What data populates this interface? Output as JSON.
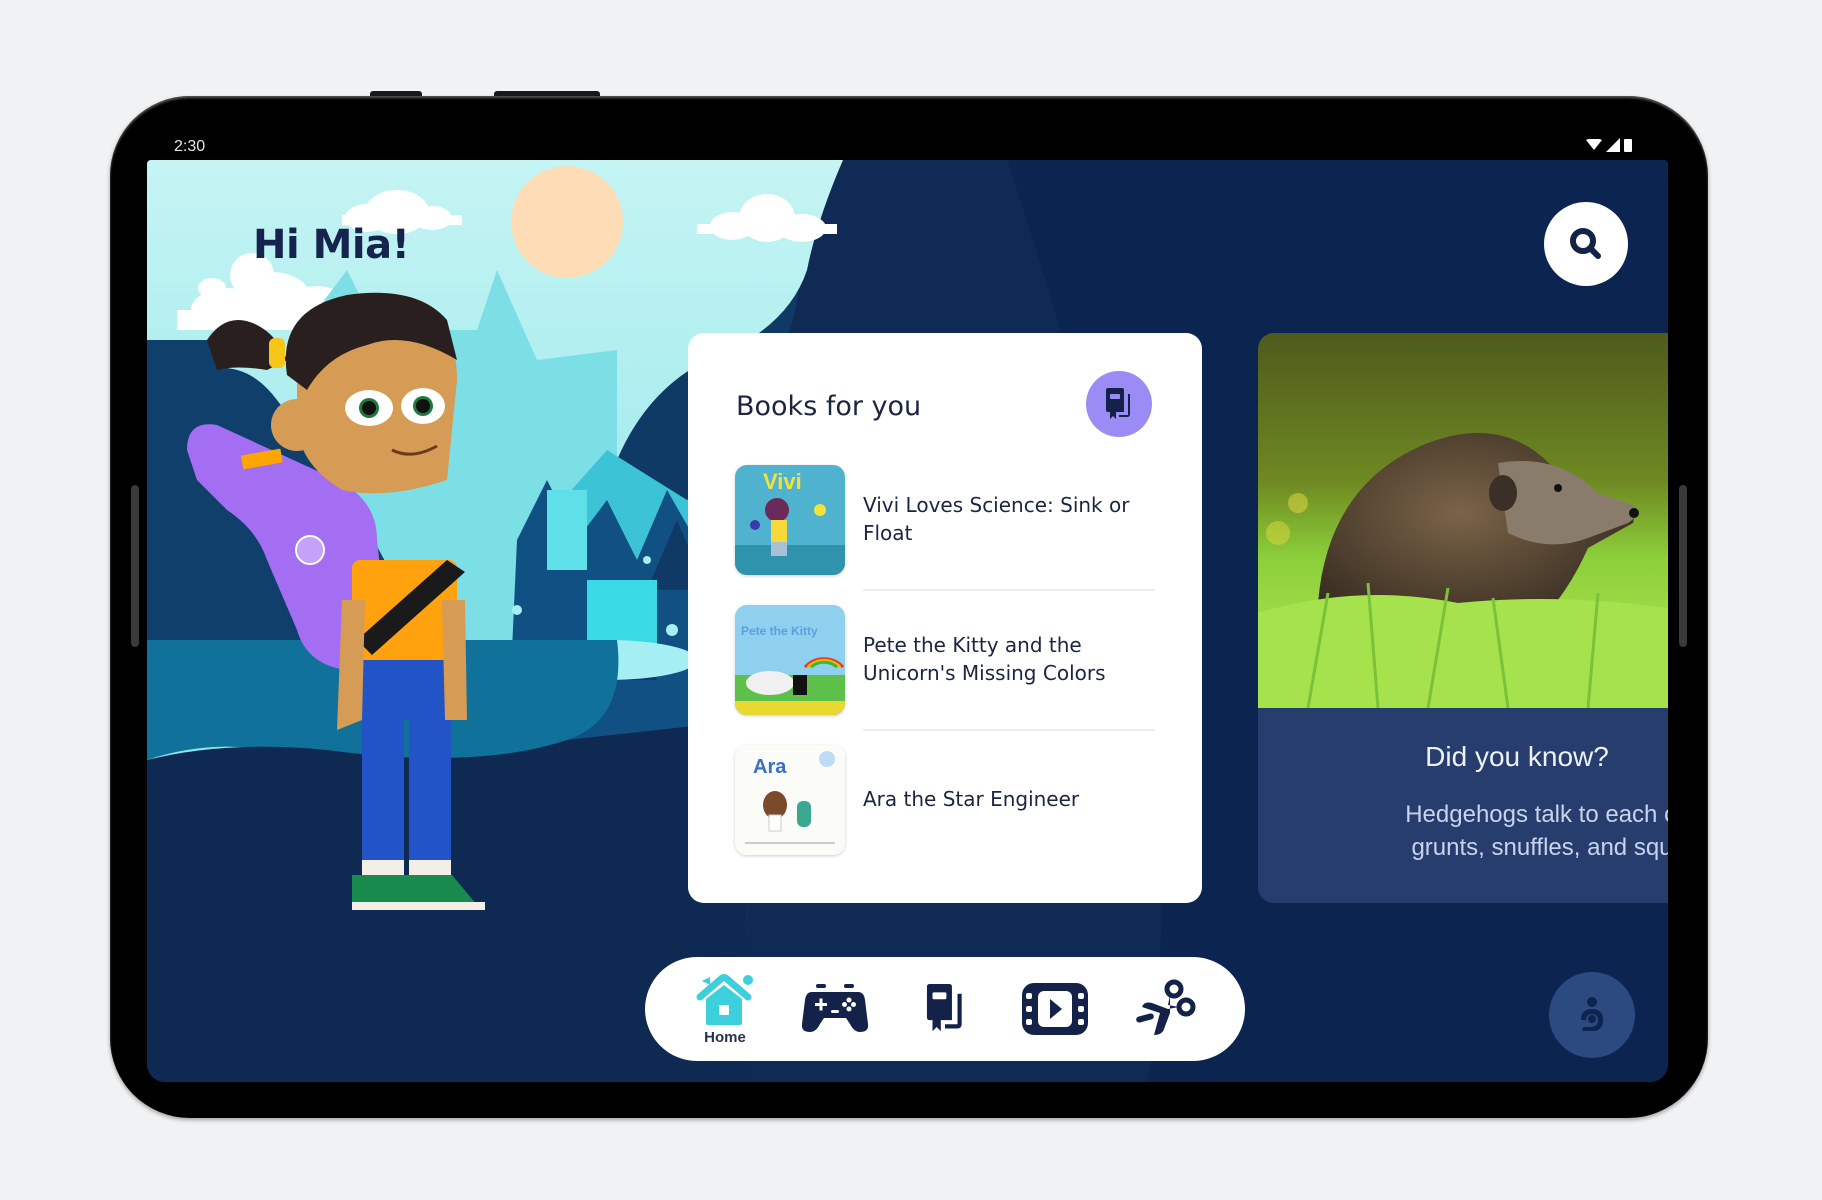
{
  "status_bar": {
    "time": "2:30",
    "icons": [
      "wifi-icon",
      "signal-icon",
      "battery-icon"
    ]
  },
  "greeting": "Hi Mia!",
  "search": {
    "icon": "search-icon"
  },
  "books": {
    "title": "Books for you",
    "badge_icon": "books-icon",
    "items": [
      {
        "title": "Vivi Loves Science: Sink or Float",
        "cover_text": "Vivi"
      },
      {
        "title": "Pete the Kitty and the Unicorn's Missing Colors",
        "cover_text": "Pete the Kitty"
      },
      {
        "title": "Ara the Star Engineer",
        "cover_text": "Ara"
      }
    ]
  },
  "fact": {
    "title": "Did you know?",
    "body_line1": "Hedgehogs talk to each othe",
    "body_line2": "grunts, snuffles, and squeal",
    "image": "hedgehog-photo"
  },
  "nav": {
    "items": [
      {
        "id": "home",
        "label": "Home",
        "icon": "home-icon",
        "active": true
      },
      {
        "id": "games",
        "label": "",
        "icon": "gamepad-icon",
        "active": false
      },
      {
        "id": "books",
        "label": "",
        "icon": "books-icon",
        "active": false
      },
      {
        "id": "videos",
        "label": "",
        "icon": "video-icon",
        "active": false
      },
      {
        "id": "crafts",
        "label": "",
        "icon": "scissors-icon",
        "active": false
      }
    ]
  },
  "parent_button": {
    "icon": "parent-icon"
  },
  "colors": {
    "accent_active": "#3ecfdc",
    "nav_icon": "#14224a",
    "books_badge": "#9b8cf5",
    "screen_bg": "#0e2a53",
    "fact_card": "#263d6d"
  }
}
